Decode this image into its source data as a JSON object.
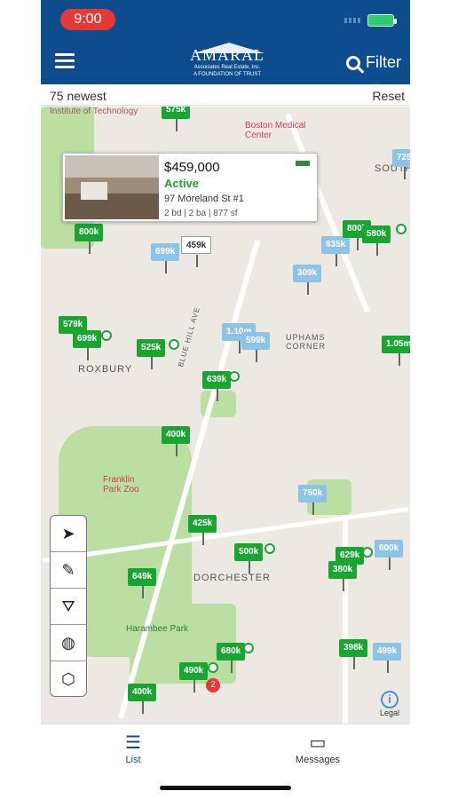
{
  "status_bar": {
    "time": "9:00"
  },
  "header": {
    "logo_name": "AMARAL",
    "logo_sub": "Associates Real Estate, Inc.",
    "logo_tagline": "A FOUNDATION OF TRUST",
    "filter_label": "Filter"
  },
  "subbar": {
    "count_label": "75 newest",
    "reset_label": "Reset"
  },
  "map": {
    "labels": [
      {
        "text": "ROXBURY"
      },
      {
        "text": "DORCHESTER"
      },
      {
        "text": "UPHAMS CORNER"
      },
      {
        "text": "BLUE HILL AVE"
      },
      {
        "text": "SOUTH"
      },
      {
        "text": "Boston Medical Center"
      },
      {
        "text": "Institute of Technology"
      },
      {
        "text": "Franklin Park Zoo"
      },
      {
        "text": "Harambee Park"
      }
    ],
    "pins": [
      {
        "label": "575k",
        "color": "green"
      },
      {
        "label": "800k",
        "color": "green"
      },
      {
        "label": "699k",
        "color": "blue"
      },
      {
        "label": "459k",
        "color": "white"
      },
      {
        "label": "935k",
        "color": "blue"
      },
      {
        "label": "800k",
        "color": "green"
      },
      {
        "label": "580k",
        "color": "green"
      },
      {
        "label": "309k",
        "color": "blue"
      },
      {
        "label": "579k",
        "color": "green"
      },
      {
        "label": "699k",
        "color": "green"
      },
      {
        "label": "525k",
        "color": "green"
      },
      {
        "label": "1.10m",
        "color": "blue"
      },
      {
        "label": "599k",
        "color": "blue"
      },
      {
        "label": "1.05m",
        "color": "green"
      },
      {
        "label": "639k",
        "color": "green"
      },
      {
        "label": "400k",
        "color": "green"
      },
      {
        "label": "750k",
        "color": "blue"
      },
      {
        "label": "425k",
        "color": "green"
      },
      {
        "label": "500k",
        "color": "green"
      },
      {
        "label": "629k",
        "color": "green"
      },
      {
        "label": "380k",
        "color": "green"
      },
      {
        "label": "600k",
        "color": "blue"
      },
      {
        "label": "649k",
        "color": "green"
      },
      {
        "label": "680k",
        "color": "green"
      },
      {
        "label": "490k",
        "color": "green"
      },
      {
        "label": "400k",
        "color": "green"
      },
      {
        "label": "398k",
        "color": "green"
      },
      {
        "label": "499k",
        "color": "blue"
      },
      {
        "label": "725",
        "color": "blue"
      }
    ],
    "cluster_count": "2",
    "legal_label": "Legal"
  },
  "callout": {
    "price": "$459,000",
    "status": "Active",
    "address": "97 Moreland St #1",
    "details": "2 bd | 2 ba | 877 sf"
  },
  "tabs": [
    {
      "label": "List"
    },
    {
      "label": "Messages"
    }
  ],
  "colors": {
    "header": "#0d4d8e",
    "active_pin": "#1aa432",
    "pending_pin": "#8fc3e6",
    "status_active": "#1aa432"
  }
}
